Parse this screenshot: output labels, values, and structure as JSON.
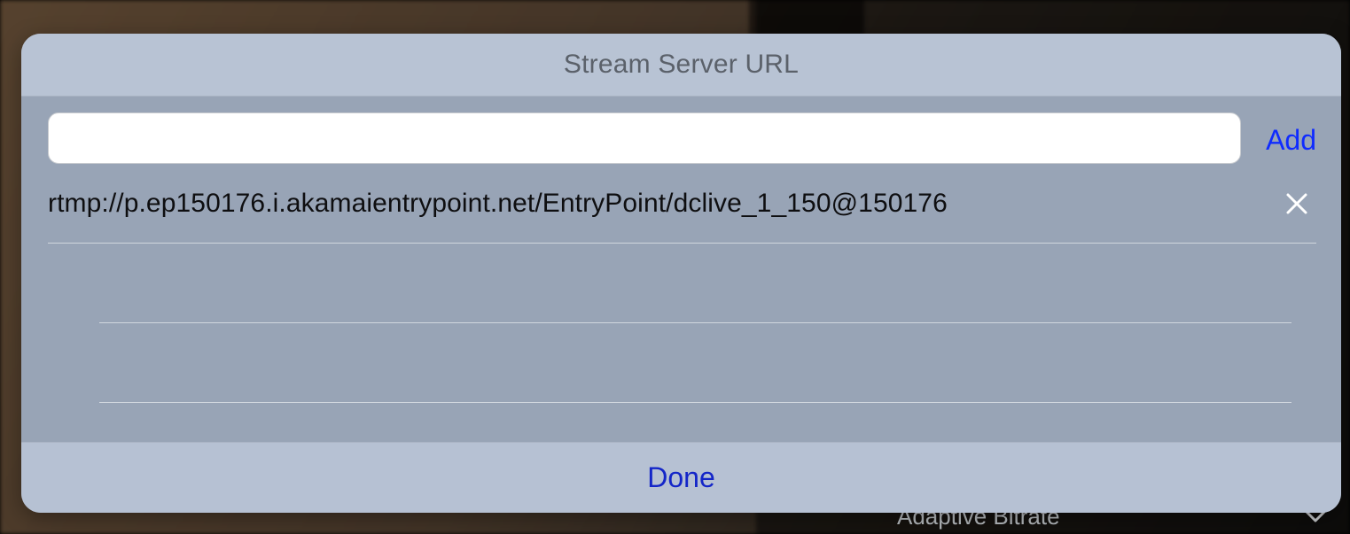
{
  "background": {
    "row_label": "Adaptive Bitrate"
  },
  "modal": {
    "title": "Stream Server URL",
    "add_label": "Add",
    "done_label": "Done",
    "input_value": "",
    "items": [
      {
        "url": "rtmp://p.ep150176.i.akamaientrypoint.net/EntryPoint/dclive_1_150@150176"
      }
    ]
  }
}
